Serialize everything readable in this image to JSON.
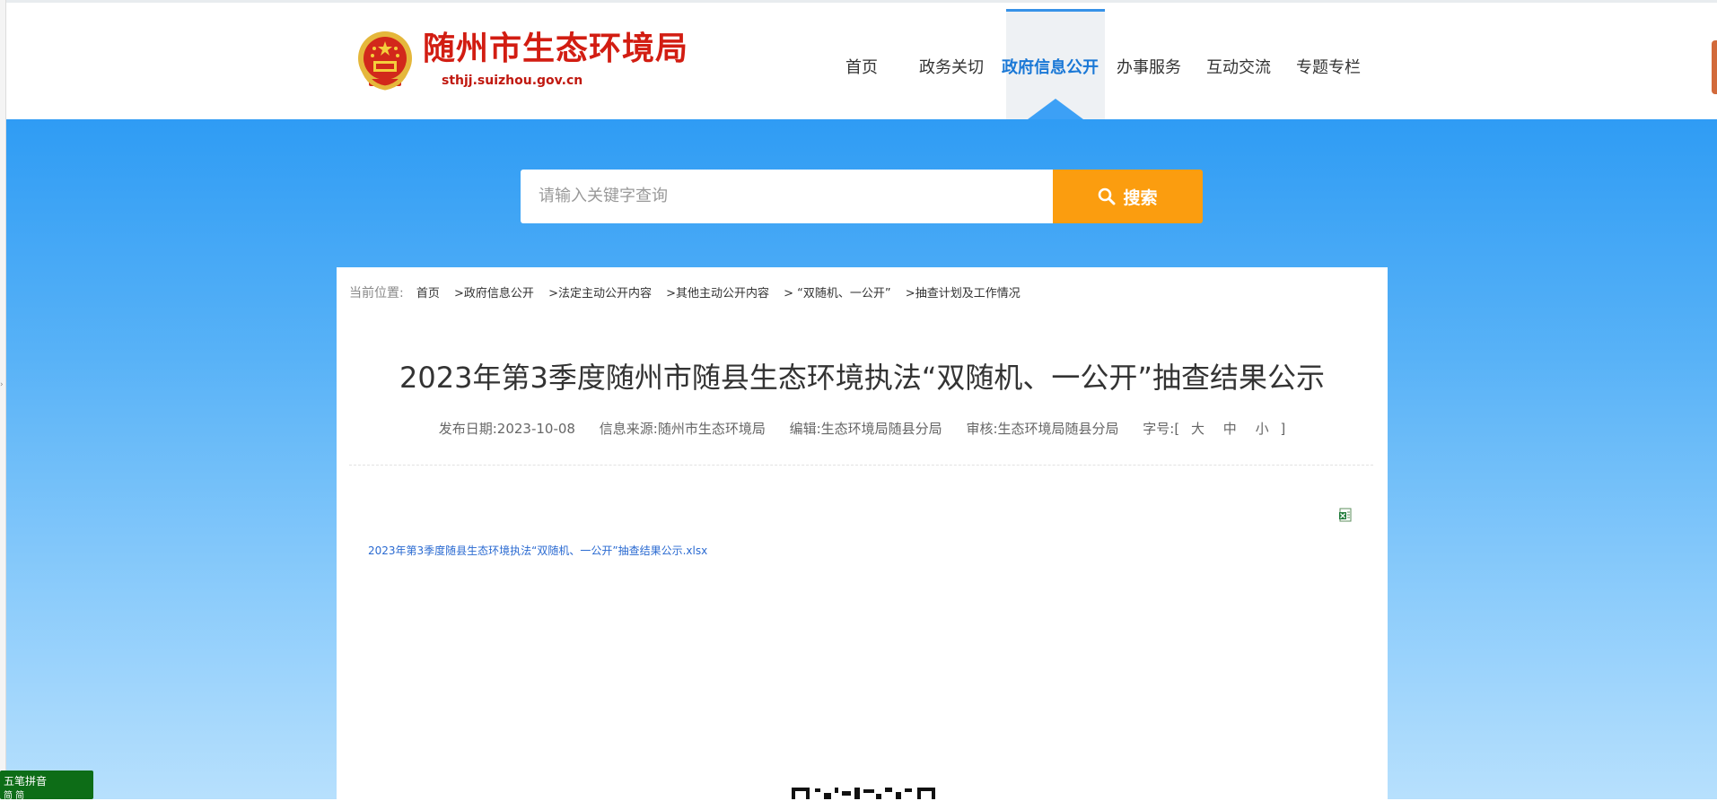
{
  "site": {
    "title": "随州市生态环境局",
    "domain": "sthjj.suizhou.gov.cn"
  },
  "nav": {
    "items": [
      {
        "label": "首页",
        "active": false
      },
      {
        "label": "政务关切",
        "active": false
      },
      {
        "label": "政府信息公开",
        "active": true
      },
      {
        "label": "办事服务",
        "active": false
      },
      {
        "label": "互动交流",
        "active": false
      },
      {
        "label": "专题专栏",
        "active": false
      }
    ]
  },
  "search": {
    "placeholder": "请输入关键字查询",
    "button_label": "搜索"
  },
  "breadcrumb": {
    "lead": "当前位置:",
    "items": [
      "首页",
      ">政府信息公开",
      ">法定主动公开内容",
      ">其他主动公开内容",
      "> “双随机、一公开”",
      ">抽查计划及工作情况"
    ]
  },
  "article": {
    "title": "2023年第3季度随州市随县生态环境执法“双随机、一公开”抽查结果公示",
    "meta": {
      "date": "发布日期:2023-10-08",
      "source": "信息来源:随州市生态环境局",
      "editor": "编辑:生态环境局随县分局",
      "reviewer": "审核:生态环境局随县分局",
      "font_size_label": "字号:[",
      "size_large": "大",
      "size_medium": "中",
      "size_small": "小",
      "font_size_close": "]"
    },
    "attachment": "2023年第3季度随县生态环境执法“双随机、一公开”抽查结果公示.xlsx"
  },
  "ime": {
    "row1": "五笔拼音",
    "row2": "简 简"
  },
  "colors": {
    "brand_red": "#d21d12",
    "nav_active": "#1a78d6",
    "search_button": "#fb9d0f",
    "banner_top": "#2f9cf4",
    "link": "#2a6ad1"
  }
}
